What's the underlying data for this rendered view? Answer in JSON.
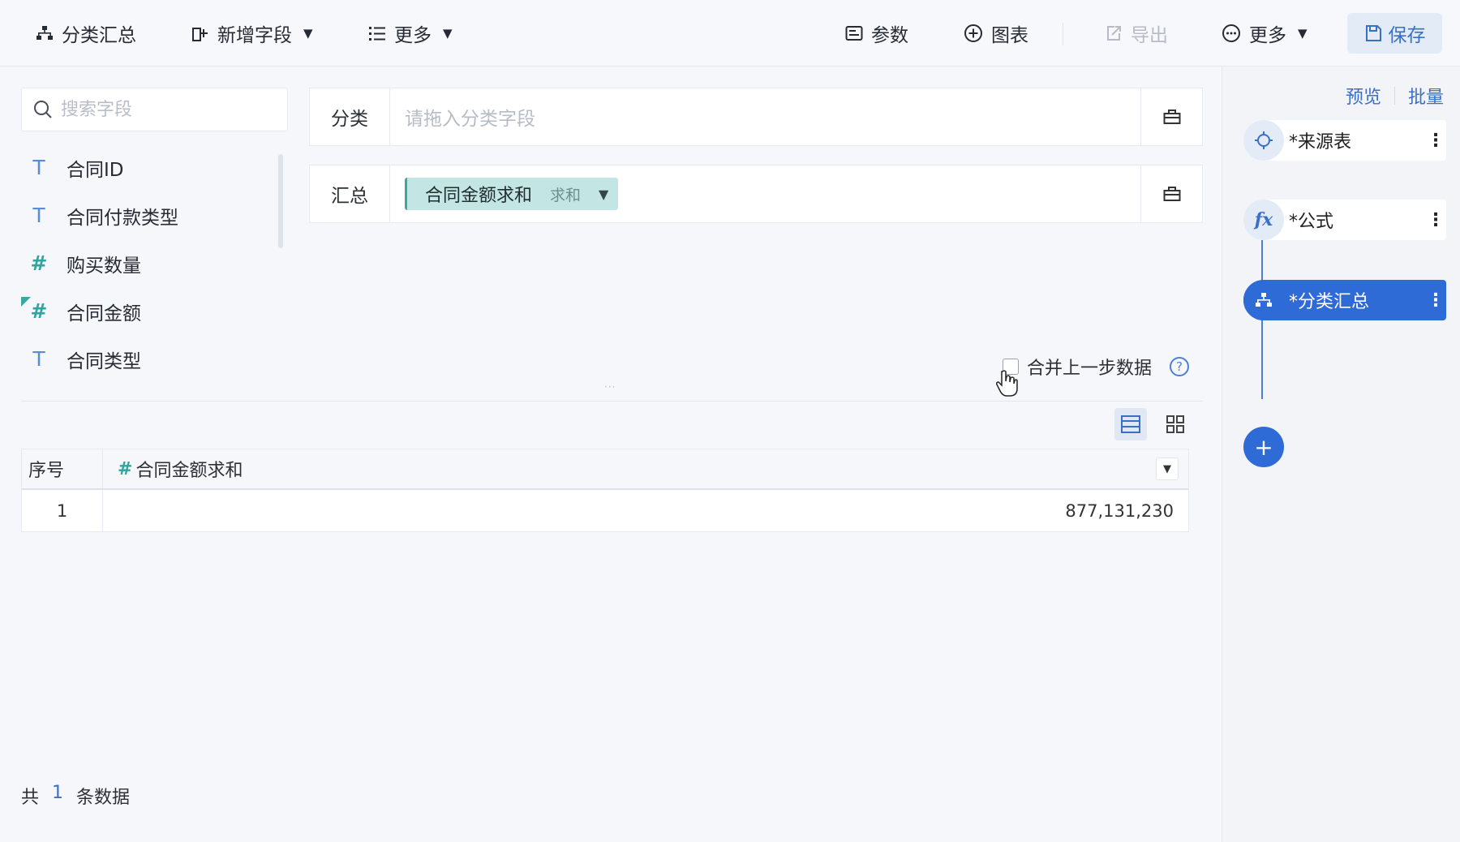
{
  "toolbar": {
    "group_summary": "分类汇总",
    "add_field": "新增字段",
    "more_left": "更多",
    "params": "参数",
    "chart": "图表",
    "export": "导出",
    "more_right": "更多",
    "save": "保存"
  },
  "search": {
    "placeholder": "搜索字段"
  },
  "fields": [
    {
      "type": "text",
      "icon": "T",
      "label": "合同ID"
    },
    {
      "type": "text",
      "icon": "T",
      "label": "合同付款类型"
    },
    {
      "type": "number",
      "icon": "#",
      "label": "购买数量"
    },
    {
      "type": "number-new",
      "icon": "#",
      "label": "合同金额"
    },
    {
      "type": "text",
      "icon": "T",
      "label": "合同类型"
    }
  ],
  "group_box": {
    "label": "分类",
    "placeholder": "请拖入分类字段"
  },
  "summary_box": {
    "label": "汇总",
    "chip": {
      "name": "合同金额求和",
      "agg": "求和"
    }
  },
  "merge": {
    "label": "合并上一步数据",
    "help": "?"
  },
  "table": {
    "headers": {
      "index": "序号",
      "value_icon": "#",
      "value": "合同金额求和"
    },
    "rows": [
      {
        "index": "1",
        "value": "877,131,230"
      }
    ]
  },
  "footer": {
    "prefix": "共",
    "count": "1",
    "suffix": "条数据"
  },
  "right_panel": {
    "preview": "预览",
    "batch": "批量",
    "steps": [
      {
        "icon": "crosshair-icon",
        "label": "*来源表",
        "active": false
      },
      {
        "icon": "fx-icon",
        "icon_text": "fx",
        "label": "*公式",
        "active": false
      },
      {
        "icon": "group-summary-icon",
        "label": "*分类汇总",
        "active": true
      }
    ],
    "add": "+"
  },
  "colors": {
    "accent": "#2f6bd6",
    "chip_bg": "#c3e6e4",
    "number_icon": "#2fa5a0"
  }
}
